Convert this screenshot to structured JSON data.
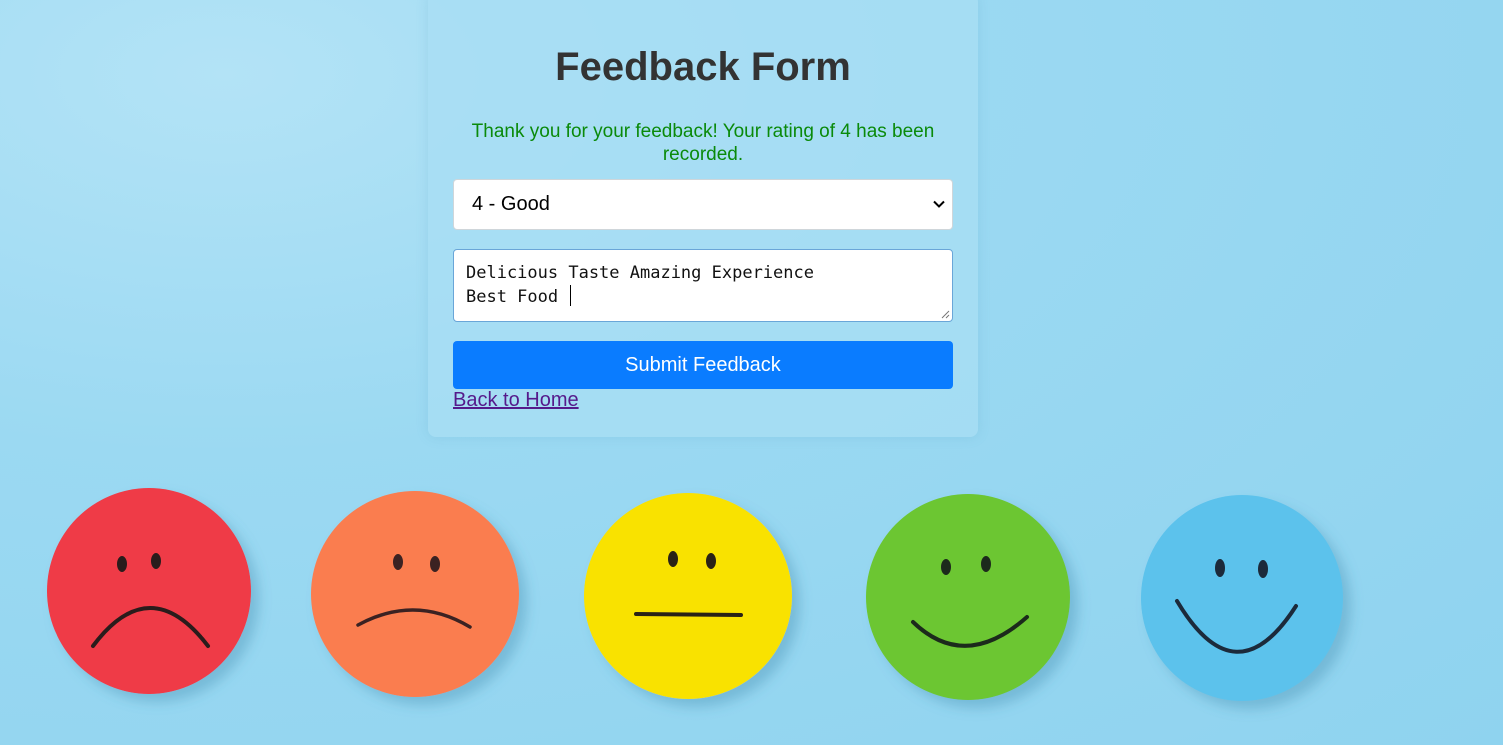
{
  "form": {
    "title": "Feedback Form",
    "success_message": "Thank you for your feedback! Your rating of 4 has been recorded.",
    "rating_select": {
      "selected": "4 - Good"
    },
    "feedback_text": {
      "line1": "Delicious Taste Amazing Experience",
      "line2": "Best Food "
    },
    "submit_label": "Submit Feedback",
    "back_link_label": "Back to Home"
  },
  "colors": {
    "success_text": "#0a8a0a",
    "submit_button": "#0a7cff",
    "visited_link": "#551a8b",
    "title_text": "#333333"
  },
  "background": {
    "faces": [
      "very-sad-face-icon",
      "sad-face-icon",
      "neutral-face-icon",
      "happy-face-icon",
      "very-happy-face-icon"
    ]
  }
}
